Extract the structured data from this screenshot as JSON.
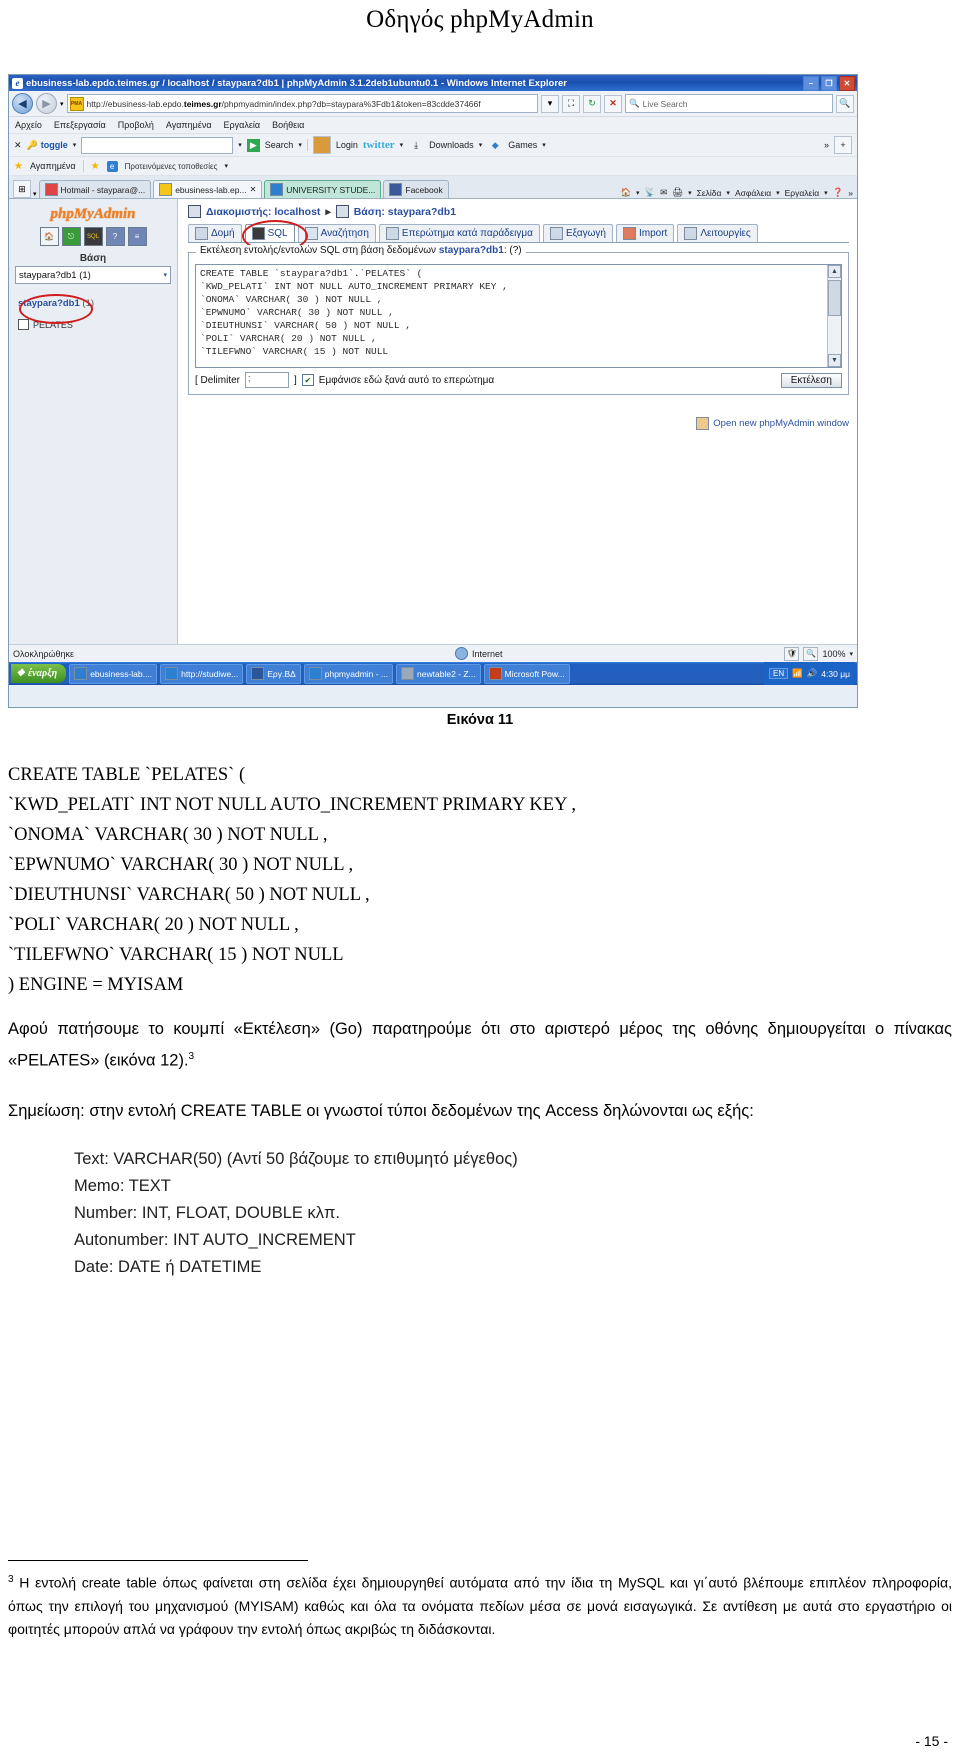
{
  "document": {
    "title": "Οδηγός phpMyAdmin",
    "figure_caption": "Εικόνα 11",
    "page_number": "- 15 -"
  },
  "screenshot": {
    "window": {
      "title": "ebusiness-lab.epdo.teimes.gr / localhost / staypara?db1 | phpMyAdmin 3.1.2deb1ubuntu0.1 - Windows Internet Explorer",
      "app_icon": "ie-icon",
      "minimize": "–",
      "maximize": "❐",
      "close": "✕"
    },
    "address_bar": {
      "back_icon": "back-arrow-icon",
      "forward_icon": "forward-arrow-icon",
      "history_icon": "chevron-down-icon",
      "site_icon": "pma-favicon",
      "url_prefix": "http://ebusiness-lab.epdo.",
      "url_domain": "teimes.gr",
      "url_suffix": "/phpmyadmin/index.php?db=staypara%3Fdb1&token=83cdde37466f",
      "dropdown_icon": "chevron-down-icon",
      "refresh_icon": "refresh-icon",
      "compat_icon": "compatibility-icon",
      "stop_icon": "stop-icon",
      "search_icon": "search-icon",
      "search_placeholder": "Live Search",
      "search_go_icon": "magnifier-icon"
    },
    "menu_items": [
      "Αρχείο",
      "Επεξεργασία",
      "Προβολή",
      "Αγαπημένα",
      "Εργαλεία",
      "Βοήθεια"
    ],
    "toolbar2": {
      "close_icon": "✕",
      "toggle_label": "toggle",
      "input_value": "",
      "search_label": "Search",
      "login_label": "Login",
      "twitter_label": "twitter",
      "downloads_label": "Downloads",
      "games_label": "Games",
      "overflow_icon": "»",
      "add_icon": "+"
    },
    "favorites_bar": {
      "favorites_label": "Αγαπημένα",
      "suggested_label": "Προτεινόμενες τοποθεσίες"
    },
    "tabs": [
      {
        "label": "Hotmail - staypara@...",
        "icon": "hotmail-icon",
        "state": "normal"
      },
      {
        "label": "ebusiness-lab.ep...",
        "icon": "pma-favicon",
        "state": "current"
      },
      {
        "label": "UNIVERSITY STUDE...",
        "icon": "ie-icon",
        "state": "active"
      },
      {
        "label": "Facebook",
        "icon": "facebook-icon",
        "state": "normal"
      }
    ],
    "command_bar": {
      "home_label": "home-icon",
      "feeds_label": "rss-icon",
      "mail_label": "mail-icon",
      "print_label": "print-icon",
      "page_label": "Σελίδα",
      "safety_label": "Ασφάλεια",
      "tools_label": "Εργαλεία",
      "help_label": "help-icon",
      "overflow": "»"
    },
    "phpmyadmin": {
      "logo": "phpMyAdmin",
      "nav_icons": [
        "home-icon",
        "exit-icon",
        "sql-icon",
        "help-icon",
        "docs-icon"
      ],
      "database_label": "Βάση",
      "database_selected": "staypara?db1 (1)",
      "tree_db": "staypara?db1",
      "tree_db_count": "(1)",
      "tree_table": "PELATES",
      "breadcrumb_server_label": "Διακομιστής: localhost",
      "breadcrumb_sep": "▸",
      "breadcrumb_db_label": "Βάση: staypara?db1",
      "tabs": [
        {
          "label": "Δομή",
          "icon": "structure-icon",
          "selected": false
        },
        {
          "label": "SQL",
          "icon": "sql-icon",
          "selected": true
        },
        {
          "label": "Αναζήτηση",
          "icon": "search-icon",
          "selected": false
        },
        {
          "label": "Επερώτημα κατά παράδειγμα",
          "icon": "query-icon",
          "selected": false
        },
        {
          "label": "Εξαγωγή",
          "icon": "export-icon",
          "selected": false
        },
        {
          "label": "Import",
          "icon": "import-icon",
          "selected": false
        },
        {
          "label": "Λειτουργίες",
          "icon": "operations-icon",
          "selected": false
        }
      ],
      "sql_panel": {
        "legend_prefix": "Εκτέλεση εντολής/εντολών SQL στη βάση δεδομένων ",
        "legend_db": "staypara?db1",
        "legend_suffix": ":",
        "help_icon": "(?)",
        "query": "CREATE TABLE `staypara?db1`.`PELATES` (\n`KWD_PELATI` INT NOT NULL AUTO_INCREMENT PRIMARY KEY ,\n`ONOMA` VARCHAR( 30 ) NOT NULL ,\n`EPWNUMO` VARCHAR( 30 ) NOT NULL ,\n`DIEUTHUNSI` VARCHAR( 50 ) NOT NULL ,\n`POLI` VARCHAR( 20 ) NOT NULL ,\n`TILEFWNO` VARCHAR( 15 ) NOT NULL",
        "delimiter_open": "[ Delimiter",
        "delimiter_value": ";",
        "delimiter_close": "]",
        "checkbox_checked": true,
        "checkbox_label": "Εμφάνισε εδώ ξανά αυτό το επερώτημα",
        "execute_button": "Εκτέλεση"
      },
      "open_new_window": "Open new phpMyAdmin window"
    },
    "status_bar": {
      "left": "Ολοκληρώθηκε",
      "zone": "Internet",
      "zone_icon": "globe-icon",
      "protected_icon": "shield-icon",
      "zoom": "100%",
      "zoom_dropdown_icon": "chevron-down-icon"
    },
    "taskbar": {
      "start_label": "έναρξη",
      "items": [
        {
          "label": "ebusiness-lab....",
          "icon": "ie-icon"
        },
        {
          "label": "http://studiwe...",
          "icon": "ie-icon"
        },
        {
          "label": "Εργ.ΒΔ",
          "icon": "word-icon"
        },
        {
          "label": "phpmyadmin - ...",
          "icon": "ie-icon"
        },
        {
          "label": "newtable2 - Z...",
          "icon": "doc-icon"
        },
        {
          "label": "Microsoft Pow...",
          "icon": "ppt-icon"
        }
      ],
      "language": "EN",
      "clock": "4:30 μμ"
    }
  },
  "content": {
    "sql_lines": [
      "CREATE TABLE `PELATES` (",
      "`KWD_PELATI` INT NOT NULL AUTO_INCREMENT PRIMARY KEY ,",
      "`ONOMA` VARCHAR( 30 ) NOT NULL ,",
      "`EPWNUMO` VARCHAR( 30 ) NOT NULL ,",
      "`DIEUTHUNSI` VARCHAR( 50 ) NOT NULL ,",
      "`POLI` VARCHAR( 20 ) NOT NULL ,",
      "`TILEFWNO` VARCHAR( 15 ) NOT NULL",
      ") ENGINE = MYISAM"
    ],
    "paragraph_1": "Αφού πατήσουμε το κουμπί «Εκτέλεση» (Go) παρατηρούμε ότι στο αριστερό μέρος της οθόνης δημιουργείται ο πίνακας «PELATES» (εικόνα 12).",
    "paragraph_1_sup": "3",
    "paragraph_2": "Σημείωση: στην εντολή CREATE TABLE οι γνωστοί τύποι δεδομένων της Access δηλώνονται ως εξής:",
    "type_lines": [
      "Text: VARCHAR(50) (Αντί 50 βάζουμε το επιθυμητό μέγεθος)",
      "Memo: TEXT",
      "Number: INT, FLOAT, DOUBLE κλπ.",
      "Autonumber: INT AUTO_INCREMENT",
      "Date: DATE ή DATETIME"
    ],
    "footnote_marker": "3",
    "footnote_text": "Η εντολή create table όπως φαίνεται στη σελίδα έχει δημιουργηθεί αυτόματα από την ίδια τη MySQL και γι΄αυτό βλέπουμε επιπλέον πληροφορία, όπως την επιλογή του μηχανισμού (MYISAM) καθώς και όλα τα ονόματα πεδίων μέσα σε μονά εισαγωγικά. Σε αντίθεση με αυτά στο εργαστήριο οι φοιτητές μπορούν απλά να γράφουν την εντολή όπως ακριβώς τη διδάσκονται."
  }
}
